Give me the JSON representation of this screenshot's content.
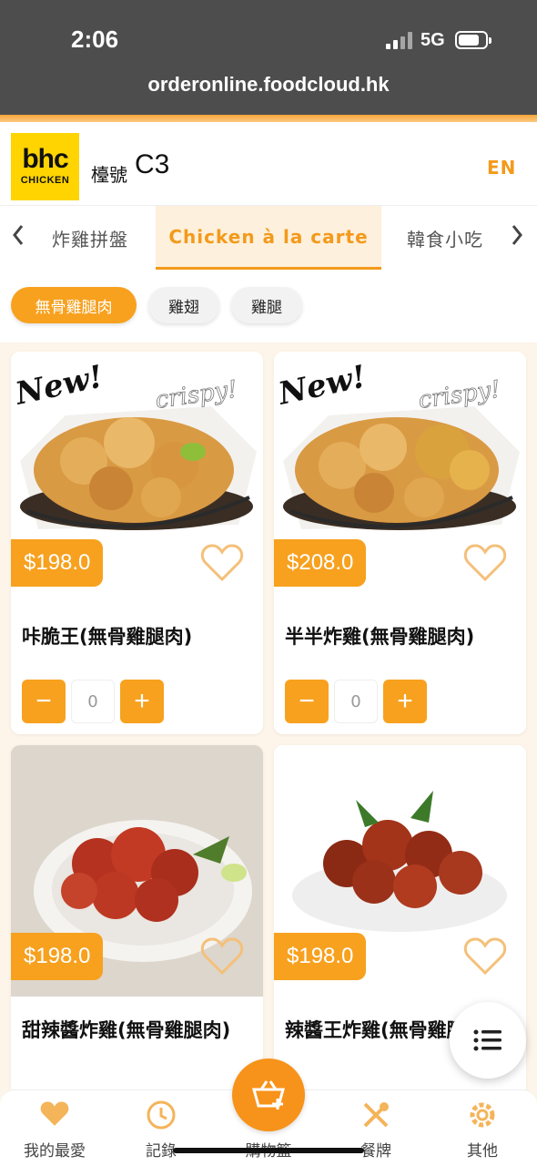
{
  "status_bar": {
    "time": "2:06",
    "network": "5G"
  },
  "browser": {
    "url": "orderonline.foodcloud.hk"
  },
  "header": {
    "logo_line1": "bhc",
    "logo_line2": "CHICKEN",
    "table_label": "檯號",
    "table_number": "C3",
    "language_toggle": "EN"
  },
  "categories": {
    "tabs": [
      {
        "label": "炸雞拼盤",
        "active": false
      },
      {
        "label": "Chicken à la carte",
        "active": true
      },
      {
        "label": "韓食小吃",
        "active": false
      }
    ]
  },
  "sub_filters": [
    {
      "label": "無骨雞腿肉",
      "active": true
    },
    {
      "label": "雞翅",
      "active": false
    },
    {
      "label": "雞腿",
      "active": false
    }
  ],
  "products": [
    {
      "price": "$198.0",
      "name": "咔脆王(無骨雞腿肉)",
      "quantity": "0",
      "image_text_new": "New!",
      "image_text_crispy": "crispy!"
    },
    {
      "price": "$208.0",
      "name": "半半炸雞(無骨雞腿肉)",
      "quantity": "0",
      "image_text_new": "New!",
      "image_text_crispy": "crispy!"
    },
    {
      "price": "$198.0",
      "name": "甜辣醬炸雞(無骨雞腿肉)"
    },
    {
      "price": "$198.0",
      "name": "辣醬王炸雞(無骨雞腿肉)"
    }
  ],
  "bottom_nav": {
    "items": [
      {
        "label": "我的最愛",
        "icon": "heart-icon"
      },
      {
        "label": "記錄",
        "icon": "clock-icon"
      },
      {
        "label": "購物籃",
        "icon": "basket-icon"
      },
      {
        "label": "餐牌",
        "icon": "utensils-icon"
      },
      {
        "label": "其他",
        "icon": "gear-icon"
      }
    ]
  },
  "colors": {
    "accent": "#f7a11f",
    "status_bar": "#4d4d4d",
    "logo_yellow": "#ffd400"
  }
}
